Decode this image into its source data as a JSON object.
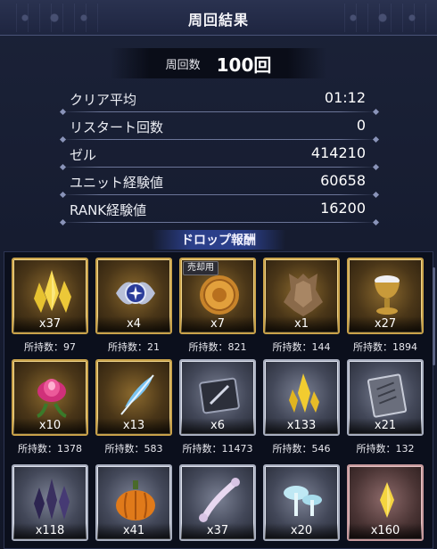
{
  "title": "周回結果",
  "runs": {
    "label": "周回数",
    "value": "100回"
  },
  "stats": [
    {
      "label": "クリア平均",
      "value": "01:12"
    },
    {
      "label": "リスタート回数",
      "value": "0"
    },
    {
      "label": "ゼル",
      "value": "414210"
    },
    {
      "label": "ユニット経験値",
      "value": "60658"
    },
    {
      "label": "RANK経験値",
      "value": "16200"
    }
  ],
  "drops_header": "ドロップ報酬",
  "items": [
    {
      "icon": "gold-crystal-cluster-icon",
      "count": "x37",
      "owned": "所持数：97",
      "frame": "gold",
      "badge": ""
    },
    {
      "icon": "ornate-silver-emblem-icon",
      "count": "x4",
      "owned": "所持数：21",
      "frame": "gold",
      "badge": ""
    },
    {
      "icon": "gold-coin-icon",
      "count": "x7",
      "owned": "所持数：821",
      "frame": "gold",
      "badge": "売却用"
    },
    {
      "icon": "beast-hide-icon",
      "count": "x1",
      "owned": "所持数：144",
      "frame": "gold",
      "badge": ""
    },
    {
      "icon": "golden-chalice-icon",
      "count": "x27",
      "owned": "所持数：1894",
      "frame": "gold",
      "badge": ""
    },
    {
      "icon": "pink-flower-icon",
      "count": "x10",
      "owned": "所持数：1378",
      "frame": "gold",
      "badge": ""
    },
    {
      "icon": "blue-feather-icon",
      "count": "x13",
      "owned": "所持数：583",
      "frame": "gold",
      "badge": ""
    },
    {
      "icon": "dark-tablet-icon",
      "count": "x6",
      "owned": "所持数：11473",
      "frame": "silver",
      "badge": ""
    },
    {
      "icon": "yellow-crystal-icon",
      "count": "x133",
      "owned": "所持数：546",
      "frame": "silver",
      "badge": ""
    },
    {
      "icon": "engraved-book-icon",
      "count": "x21",
      "owned": "所持数：132",
      "frame": "silver",
      "badge": ""
    },
    {
      "icon": "dark-crystal-cluster-icon",
      "count": "x118",
      "owned": "",
      "frame": "silver",
      "badge": ""
    },
    {
      "icon": "pumpkin-icon",
      "count": "x41",
      "owned": "",
      "frame": "silver",
      "badge": ""
    },
    {
      "icon": "bone-icon",
      "count": "x37",
      "owned": "",
      "frame": "silver",
      "badge": ""
    },
    {
      "icon": "glowing-mushroom-icon",
      "count": "x20",
      "owned": "",
      "frame": "silver",
      "badge": ""
    },
    {
      "icon": "small-gold-crystal-icon",
      "count": "x160",
      "owned": "",
      "frame": "pink",
      "badge": ""
    }
  ]
}
